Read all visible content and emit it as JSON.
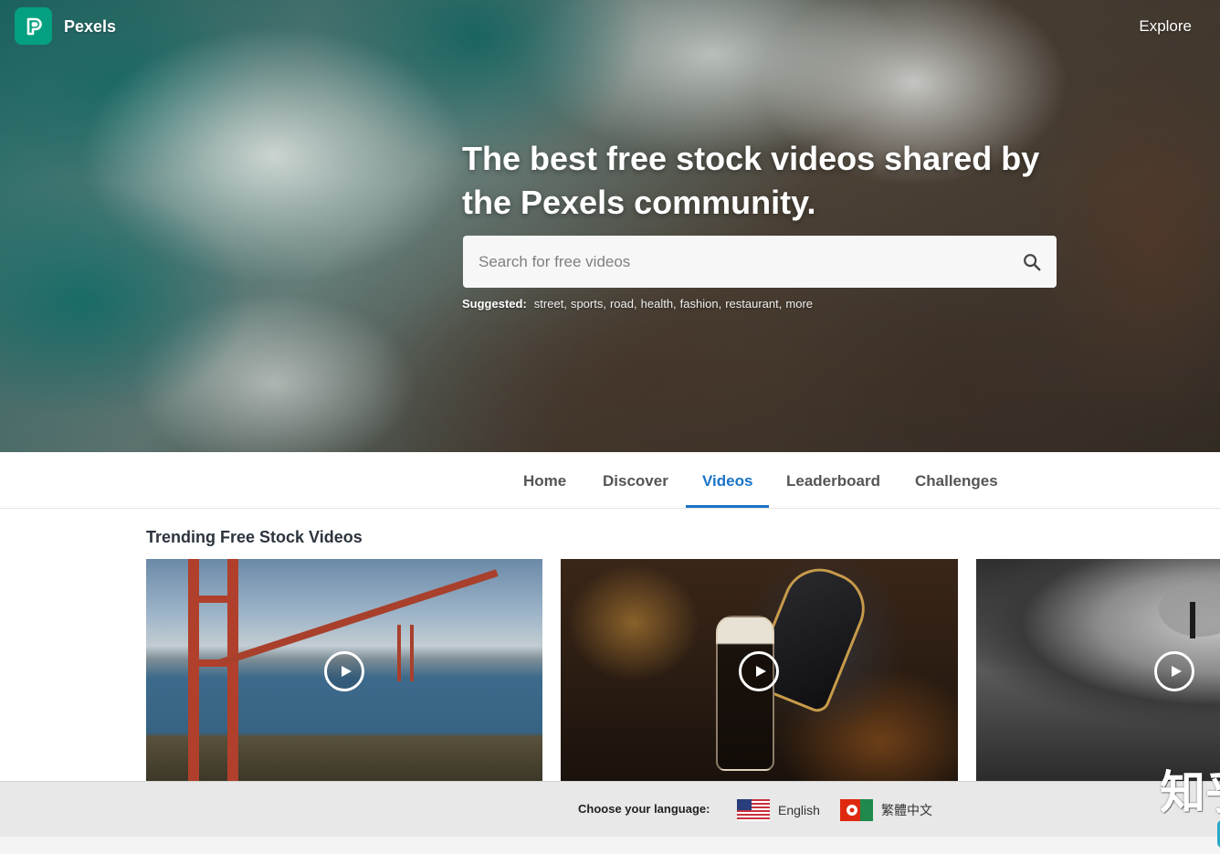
{
  "header": {
    "brand": "Pexels",
    "explore_label": "Explore"
  },
  "hero": {
    "headline": "The best free stock videos shared by the Pexels community.",
    "search": {
      "placeholder": "Search for free videos"
    },
    "suggested": {
      "label": "Suggested:",
      "tags": [
        "street",
        "sports",
        "road",
        "health",
        "fashion",
        "restaurant",
        "more"
      ]
    }
  },
  "nav": {
    "items": [
      {
        "label": "Home",
        "active": false
      },
      {
        "label": "Discover",
        "active": false
      },
      {
        "label": "Videos",
        "active": true
      },
      {
        "label": "Leaderboard",
        "active": false
      },
      {
        "label": "Challenges",
        "active": false
      }
    ]
  },
  "trending": {
    "title": "Trending Free Stock Videos",
    "videos": [
      {
        "icon": "play-icon"
      },
      {
        "icon": "play-icon"
      },
      {
        "icon": "play-icon"
      }
    ]
  },
  "language_bar": {
    "label": "Choose your language:",
    "options": [
      {
        "label": "English",
        "icon": "us-flag-icon"
      },
      {
        "label": "繁體中文",
        "icon": "hk-flag-icon"
      }
    ]
  },
  "watermark": {
    "text": "知乎"
  },
  "colors": {
    "brand": "#05a081",
    "accent": "#1a73c8"
  }
}
